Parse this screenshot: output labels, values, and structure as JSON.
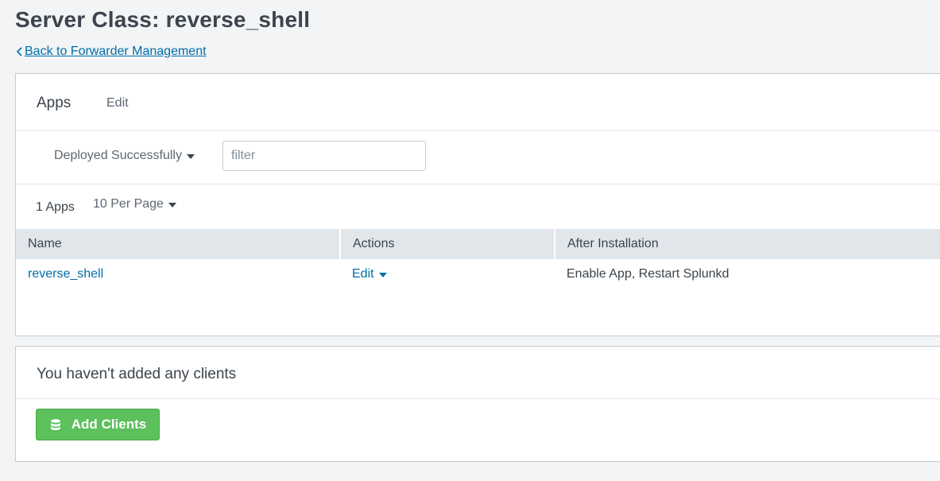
{
  "page": {
    "title": "Server Class: reverse_shell",
    "back_link": "Back to Forwarder Management"
  },
  "apps_panel": {
    "title": "Apps",
    "edit_label": "Edit",
    "status_filter": "Deployed Successfully",
    "filter_placeholder": "filter",
    "app_count": "1 Apps",
    "per_page": "10 Per Page",
    "columns": [
      "Name",
      "Actions",
      "After Installation"
    ],
    "rows": [
      {
        "name": "reverse_shell",
        "action": "Edit",
        "after_installation": "Enable App, Restart Splunkd"
      }
    ]
  },
  "clients_panel": {
    "message": "You haven't added any clients",
    "add_button": "Add Clients"
  },
  "colors": {
    "link": "#006eaa",
    "button_green": "#5cc05c",
    "table_header_bg": "#e1e6eb",
    "page_bg": "#f2f4f5"
  },
  "icons": {
    "back": "chevron-left-icon",
    "dropdown": "caret-down-icon",
    "add_clients": "database-icon"
  }
}
